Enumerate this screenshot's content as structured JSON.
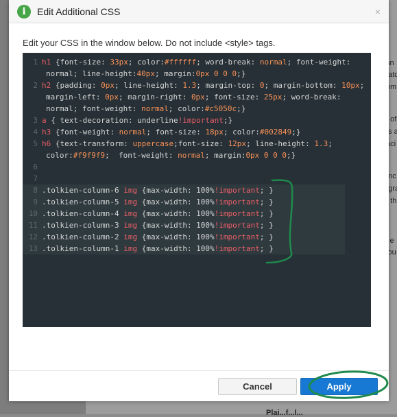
{
  "background": {
    "fragments": [
      "inn",
      "pato",
      "mmu",
      "e of",
      "us a",
      "faci",
      "unc",
      "ogra",
      "g th",
      "s e",
      "you"
    ],
    "bottom_text": "Plai...f...l..."
  },
  "dialog": {
    "title": "Edit Additional CSS",
    "close_glyph": "×",
    "info_glyph": "i",
    "instructions": "Edit your CSS in the window below. Do not include <style> tags.",
    "code_lines": [
      {
        "n": "1",
        "text": "h1 {font-size: 33px; color:#ffffff; word-break: normal; font-weight:",
        "cont": "normal; line-height:40px; margin:0px 0 0 0;}"
      },
      {
        "n": "2",
        "text": "h2 {padding: 0px; line-height: 1.3; margin-top: 0; margin-bottom: 10px;",
        "cont": "margin-left: 0px; margin-right: 0px; font-size: 25px; word-break:",
        "cont2": "normal; font-weight: normal; color:#c5050c;}"
      },
      {
        "n": "3",
        "text": "a { text-decoration: underline!important;}"
      },
      {
        "n": "4",
        "text": "h3 {font-weight: normal; font-size: 18px; color:#002849;}"
      },
      {
        "n": "5",
        "text": "h6 {text-transform: uppercase;font-size: 12px; line-height: 1.3;",
        "cont": "color:#f9f9f9;  font-weight: normal; margin:0px 0 0 0;}"
      },
      {
        "n": "6",
        "text": ""
      },
      {
        "n": "7",
        "text": ""
      },
      {
        "n": "8",
        "text": ".tolkien-column-6 img {max-width: 100%!important; }"
      },
      {
        "n": "9",
        "text": ".tolkien-column-5 img {max-width: 100%!important; }"
      },
      {
        "n": "10",
        "text": ".tolkien-column-4 img {max-width: 100%!important; }"
      },
      {
        "n": "11",
        "text": ".tolkien-column-3 img {max-width: 100%!important; }"
      },
      {
        "n": "12",
        "text": ".tolkien-column-2 img {max-width: 100%!important; }"
      },
      {
        "n": "13",
        "text": ".tolkien-column-1 img {max-width: 100%!important; }"
      }
    ],
    "cancel_label": "Cancel",
    "apply_label": "Apply"
  },
  "colors": {
    "editor_bg": "#263036",
    "apply_bg": "#1779d4",
    "annotation_green": "#1f8a4c",
    "info_green": "#46a546"
  }
}
